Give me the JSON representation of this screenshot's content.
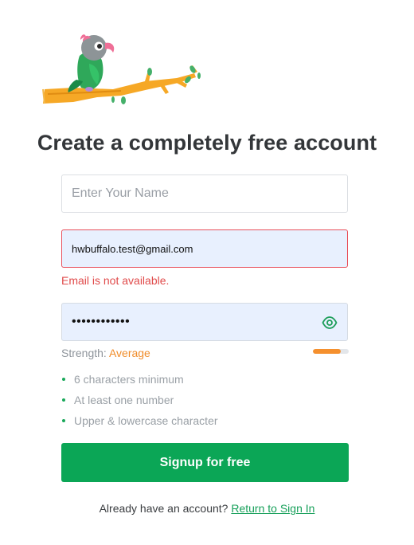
{
  "header": {
    "title": "Create a completely free account"
  },
  "logo": {
    "icon": "parrot-on-branch-logo"
  },
  "form": {
    "name": {
      "value": "",
      "placeholder": "Enter Your Name"
    },
    "email": {
      "value": "hwbuffalo.test@gmail.com",
      "placeholder": "",
      "error": "Email is not available."
    },
    "password": {
      "value": "••••••••••••",
      "toggle_icon": "eye-icon"
    },
    "strength": {
      "label": "Strength:",
      "level": "Average",
      "fraction": 0.78,
      "color": "#f5902e"
    },
    "rules": [
      "6 characters minimum",
      "At least one number",
      "Upper & lowercase character"
    ],
    "submit_label": "Signup for free"
  },
  "footer": {
    "prompt": "Already have an account?",
    "link": "Return to Sign In"
  },
  "colors": {
    "accent": "#0ba656",
    "error": "#e04a4a",
    "title": "#333639"
  }
}
